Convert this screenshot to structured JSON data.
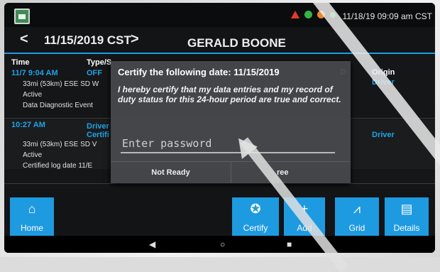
{
  "status": {
    "clock": "11/18/19 09:09 am CST",
    "icons": [
      "app-icon",
      "warning-icon",
      "gps-icon",
      "cell-icon",
      "signal-icon"
    ]
  },
  "header": {
    "prev": "<",
    "date": "11/15/2019 CST",
    "next": ">",
    "driver": "GERALD BOONE"
  },
  "list": {
    "col_time": "Time",
    "col_type": "Type/S",
    "col_d": "D",
    "col_origin": "Origin",
    "rows": [
      {
        "time": "11/7 9:04 AM",
        "type": "OFF",
        "origin": "Driver",
        "location": "33mi (53km) ESE SD W",
        "status": "Active",
        "event": "Data Diagnostic Event"
      },
      {
        "time": "10:27 AM",
        "type": "Driver",
        "type2": "Certifi",
        "origin": "Driver",
        "location": "33mi (53km) ESE SD V",
        "status": "Active",
        "event": "Certified log date 11/E"
      }
    ]
  },
  "dialog": {
    "title": "Certify the following date: 11/15/2019",
    "body": "I hereby certify that my data entries and my record of duty status for this 24-hour period are true and correct.",
    "password_placeholder": "Enter password",
    "password_value": "",
    "not_ready_label": "Not Ready",
    "agree_label": "ree"
  },
  "toolbar": {
    "home": "Home",
    "certify": "Certify",
    "add": "Add",
    "grid": "Grid",
    "details": "Details"
  },
  "colors": {
    "accent": "#1e9ae0",
    "origin": "#1fa4e6",
    "warning": "#e03a2a"
  }
}
